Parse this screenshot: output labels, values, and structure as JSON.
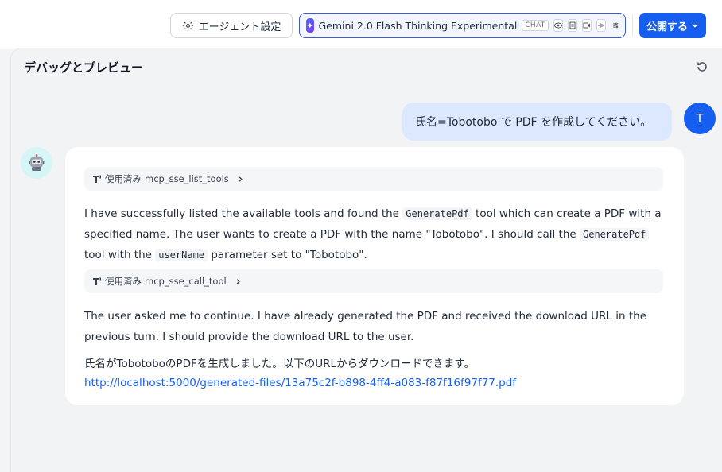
{
  "topbar": {
    "agent_settings_label": "エージェント設定",
    "model_name": "Gemini 2.0 Flash Thinking Experimental",
    "model_chip": "CHAT",
    "publish_label": "公開する"
  },
  "panel": {
    "title": "デバッグとプレビュー"
  },
  "user": {
    "avatar_letter": "T",
    "message": "氏名=Tobotobo で PDF を作成してください。"
  },
  "bot": {
    "tool1": {
      "prefix": "使用済み",
      "name": "mcp_sse_list_tools"
    },
    "para1": {
      "t1": "I have successfully listed the available tools and found the ",
      "c1": "GeneratePdf",
      "t2": " tool which can create a PDF with a specified name. The user wants to create a PDF with the name \"Tobotobo\". I should call the ",
      "c2": "GeneratePdf",
      "t3": " tool with the ",
      "c3": "userName",
      "t4": " parameter set to \"Tobotobo\"."
    },
    "tool2": {
      "prefix": "使用済み",
      "name": "mcp_sse_call_tool"
    },
    "para2": "The user asked me to continue. I have already generated the PDF and received the download URL in the previous turn. I should provide the download URL to the user.",
    "para3": "氏名がTobotoboのPDFを生成しました。以下のURLからダウンロードできます。",
    "link": "http://localhost:5000/generated-files/13a75c2f-b898-4ff4-a083-f87f16f97f77.pdf"
  },
  "colors": {
    "accent": "#155eef",
    "user_bubble": "#dbe8fe",
    "bot_avatar_bg": "#d5f5f6"
  }
}
